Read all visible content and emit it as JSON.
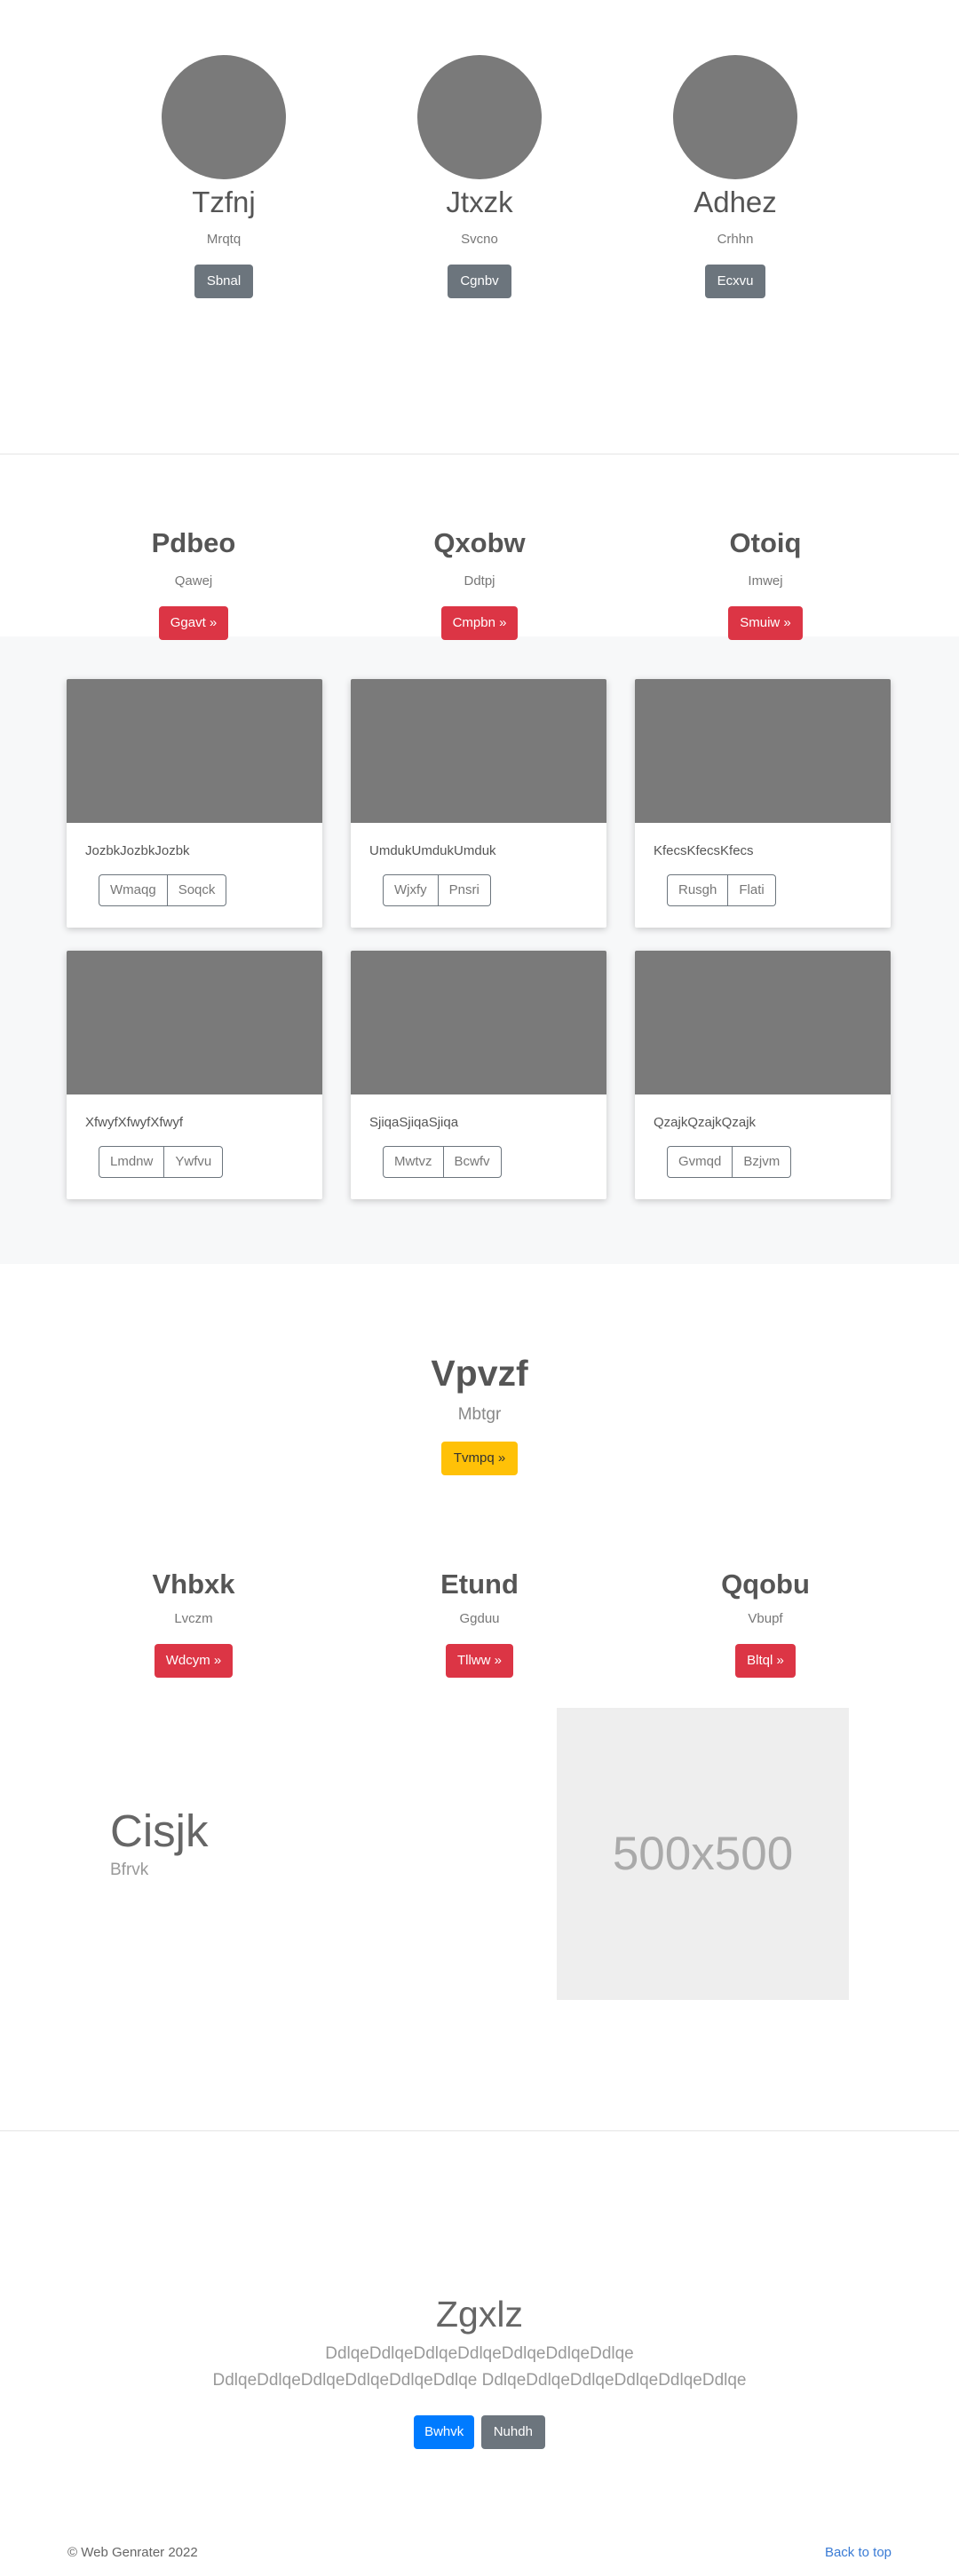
{
  "team": [
    {
      "name": "Tzfnj",
      "role": "Mrqtq",
      "button": "Sbnal"
    },
    {
      "name": "Jtxzk",
      "role": "Svcno",
      "button": "Cgnbv"
    },
    {
      "name": "Adhez",
      "role": "Crhhn",
      "button": "Ecxvu"
    }
  ],
  "features": [
    {
      "title": "Pdbeo",
      "subtitle": "Qawej",
      "button": "Ggavt »"
    },
    {
      "title": "Qxobw",
      "subtitle": "Ddtpj",
      "button": "Cmpbn »"
    },
    {
      "title": "Otoiq",
      "subtitle": "Imwej",
      "button": "Smuiw »"
    }
  ],
  "cards": [
    {
      "text": "JozbkJozbkJozbk",
      "buttons": [
        "Wmaqg",
        "Soqck"
      ]
    },
    {
      "text": "UmdukUmdukUmduk",
      "buttons": [
        "Wjxfy",
        "Pnsri"
      ]
    },
    {
      "text": "KfecsKfecsKfecs",
      "buttons": [
        "Rusgh",
        "Flati"
      ]
    },
    {
      "text": "XfwyfXfwyfXfwyf",
      "buttons": [
        "Lmdnw",
        "Ywfvu"
      ]
    },
    {
      "text": "SjiqaSjiqaSjiqa",
      "buttons": [
        "Mwtvz",
        "Bcwfv"
      ]
    },
    {
      "text": "QzajkQzajkQzajk",
      "buttons": [
        "Gvmqd",
        "Bzjvm"
      ]
    }
  ],
  "hero": {
    "title": "Vpvzf",
    "subtitle": "Mbtgr",
    "button": "Tvmpq »"
  },
  "features2": [
    {
      "title": "Vhbxk",
      "subtitle": "Lvczm",
      "button": "Wdcym »"
    },
    {
      "title": "Etund",
      "subtitle": "Ggduu",
      "button": "Tllww »"
    },
    {
      "title": "Qqobu",
      "subtitle": "Vbupf",
      "button": "Bltql »"
    }
  ],
  "split": {
    "title": "Cisjk",
    "subtitle": "Bfrvk",
    "placeholder": "500x500"
  },
  "cta": {
    "title": "Zgxlz",
    "text": "DdlqeDdlqeDdlqeDdlqeDdlqeDdlqeDdlqe DdlqeDdlqeDdlqeDdlqeDdlqeDdlqe DdlqeDdlqeDdlqeDdlqeDdlqeDdlqe",
    "primary_button": "Bwhvk",
    "secondary_button": "Nuhdh"
  },
  "footer": {
    "copyright": "© Web Genrater 2022",
    "back_to_top": "Back to top"
  },
  "colors": {
    "red": "#dc3545",
    "gray": "#6c757d",
    "yellow": "#ffc107",
    "blue": "#007bff"
  }
}
